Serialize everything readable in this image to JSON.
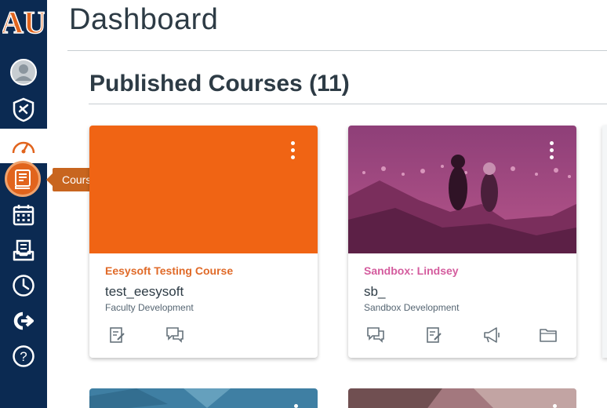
{
  "nav": {
    "logo_text": "AU",
    "items": [
      {
        "name": "account",
        "icon": "avatar-icon"
      },
      {
        "name": "admin",
        "icon": "shield-icon"
      },
      {
        "name": "dashboard",
        "icon": "dashboard-icon",
        "active": true
      },
      {
        "name": "courses",
        "icon": "courses-icon"
      },
      {
        "name": "calendar",
        "icon": "calendar-icon"
      },
      {
        "name": "inbox",
        "icon": "inbox-icon"
      },
      {
        "name": "history",
        "icon": "clock-icon"
      },
      {
        "name": "commons",
        "icon": "commons-icon"
      },
      {
        "name": "help",
        "icon": "help-icon"
      }
    ],
    "tooltip": "Courses"
  },
  "header": {
    "title": "Dashboard"
  },
  "section": {
    "title": "Published Courses (11)"
  },
  "cards": [
    {
      "name": "Eesysoft Testing Course",
      "code": "test_eesysoft",
      "term": "Faculty Development",
      "color": "#f06414",
      "name_color": "#e06a28",
      "actions": [
        "assignments-icon",
        "discussions-icon"
      ]
    },
    {
      "name": "Sandbox: Lindsey",
      "code": "sb_",
      "term": "Sandbox Development",
      "color": "#b34f86",
      "name_color": "#d45c9e",
      "actions": [
        "discussions-icon",
        "assignments-icon",
        "announcements-icon",
        "files-icon"
      ]
    }
  ],
  "colors": {
    "nav_bg": "#0b2a52",
    "accent": "#e1641d",
    "text": "#2d3b45"
  }
}
